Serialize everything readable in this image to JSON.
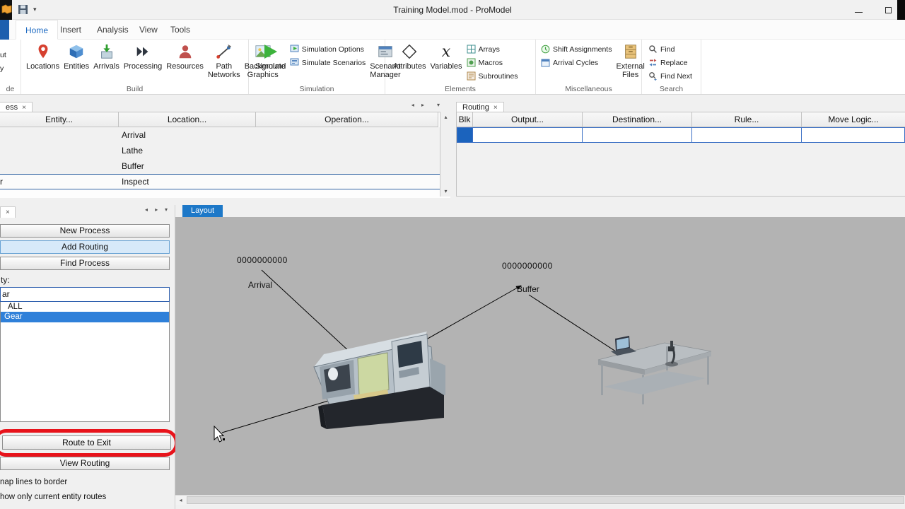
{
  "colors": {
    "accent": "#1d6ac2",
    "selection": "#2f80d9",
    "canvas_gray": "#b3b3b3",
    "annotation_red": "#e8131b",
    "blk_cell_blue": "#1b63bd"
  },
  "titlebar": {
    "title": "Training Model.mod - ProModel"
  },
  "ribbon": {
    "tabs": [
      {
        "label": "Home"
      },
      {
        "label": "Insert"
      },
      {
        "label": "Analysis"
      },
      {
        "label": "View"
      },
      {
        "label": "Tools"
      }
    ],
    "active_tab": "Home",
    "clipped": {
      "frag1": "ut",
      "frag2": "y",
      "label": "de"
    },
    "build": {
      "label": "Build",
      "items": [
        "Locations",
        "Entities",
        "Arrivals",
        "Processing",
        "Resources",
        "Path Networks",
        "Background Graphics"
      ]
    },
    "simulation": {
      "label": "Simulation",
      "simulate": "Simulate",
      "options": "Simulation Options",
      "scenarios": "Simulate Scenarios",
      "manager": "Scenario Manager"
    },
    "elements": {
      "label": "Elements",
      "attributes": "Attributes",
      "variables": "Variables",
      "items": [
        "Arrays",
        "Macros",
        "Subroutines"
      ]
    },
    "misc": {
      "label": "Miscellaneous",
      "items": [
        "Shift Assignments",
        "Arrival Cycles"
      ],
      "external": "External Files"
    },
    "search": {
      "label": "Search",
      "items": [
        "Find",
        "Replace",
        "Find Next"
      ]
    }
  },
  "process": {
    "tab": "ess",
    "close": "×",
    "headers": [
      "Entity...",
      "Location...",
      "Operation..."
    ],
    "rows": [
      {
        "entity": "",
        "location": "Arrival",
        "operation": ""
      },
      {
        "entity": "",
        "location": "Lathe",
        "operation": ""
      },
      {
        "entity": "",
        "location": "Buffer",
        "operation": ""
      },
      {
        "entity": "r",
        "location": "Inspect",
        "operation": ""
      }
    ]
  },
  "routing": {
    "tab": "Routing",
    "close": "×",
    "headers": [
      "Blk",
      "Output...",
      "Destination...",
      "Rule...",
      "Move Logic..."
    ]
  },
  "tools": {
    "tab_close": "×",
    "new_process": "New Process",
    "add_routing": "Add Routing",
    "find_process": "Find Process",
    "entity_label": "ty:",
    "entity_value": "ar",
    "list": [
      "ALL",
      "Gear"
    ],
    "selected_entity": "Gear",
    "route_to_exit": "Route to Exit",
    "view_routing": "View Routing",
    "check1": "nap lines to border",
    "check2": "how only current entity routes"
  },
  "layout": {
    "tab": "Layout",
    "arrival_id": "0000000000",
    "arrival_label": "Arrival",
    "buffer_id": "0000000000",
    "buffer_label": "Buffer"
  }
}
